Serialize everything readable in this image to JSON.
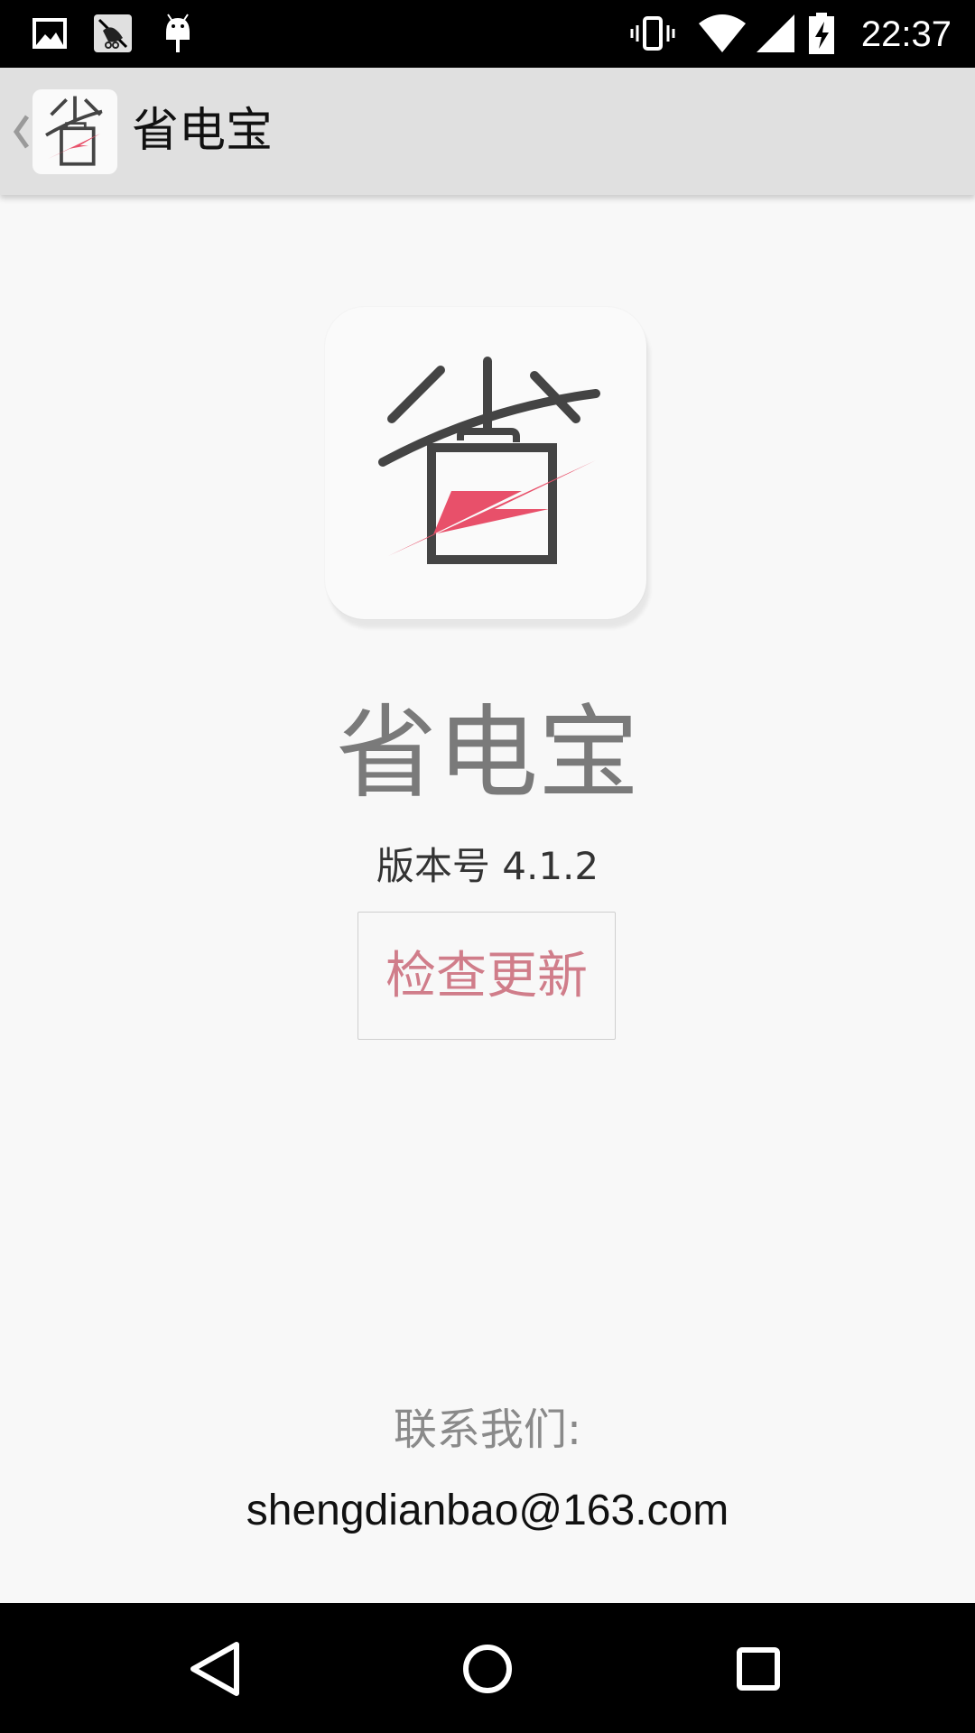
{
  "status_bar": {
    "time": "22:37",
    "left_icons": [
      "gallery-icon",
      "hidden-app-icon",
      "android-debug-icon"
    ],
    "right_icons": [
      "vibrate-icon",
      "wifi-icon",
      "cell-signal-icon",
      "battery-charging-icon"
    ]
  },
  "action_bar": {
    "title": "省电宝",
    "back_icon": "chevron-left-icon",
    "logo_icon": "app-logo-icon"
  },
  "about": {
    "app_name": "省电宝",
    "version": "版本号 4.1.2",
    "check_update_label": "检查更新",
    "contact_label": "联系我们:",
    "contact_email": "shengdianbao@163.com"
  },
  "nav_bar": {
    "buttons": [
      "back-triangle-icon",
      "home-circle-icon",
      "recents-square-icon"
    ]
  },
  "colors": {
    "accent": "#e8506a",
    "button_text": "#d07d8a",
    "action_bar": "#e0e0e0",
    "background": "#f8f8f8"
  }
}
